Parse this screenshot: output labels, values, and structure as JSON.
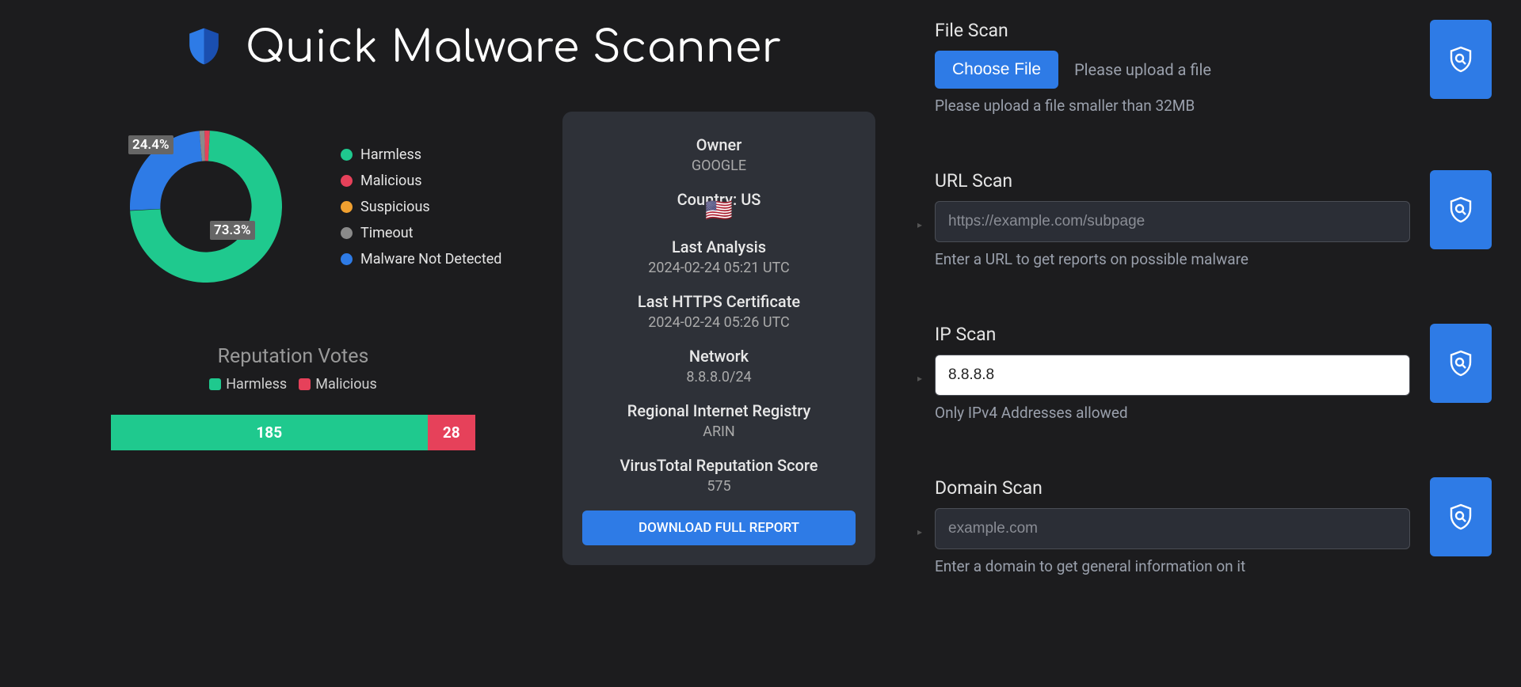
{
  "app": {
    "title": "Quick Malware Scanner"
  },
  "chart_data": {
    "type": "pie",
    "title": "",
    "series": [
      {
        "name": "Harmless",
        "value": 73.3,
        "color": "#1fc98e"
      },
      {
        "name": "Malicious",
        "value": 1.1,
        "color": "#e6415a"
      },
      {
        "name": "Suspicious",
        "value": 0,
        "color": "#f0a030"
      },
      {
        "name": "Timeout",
        "value": 1.1,
        "color": "#8a8a8a"
      },
      {
        "name": "Malware Not Detected",
        "value": 24.4,
        "color": "#2e7be6"
      }
    ],
    "labels_shown": [
      "73.3%",
      "24.4%"
    ]
  },
  "legend": [
    {
      "label": "Harmless",
      "color": "#1fc98e"
    },
    {
      "label": "Malicious",
      "color": "#e6415a"
    },
    {
      "label": "Suspicious",
      "color": "#f0a030"
    },
    {
      "label": "Timeout",
      "color": "#8a8a8a"
    },
    {
      "label": "Malware Not Detected",
      "color": "#2e7be6"
    }
  ],
  "reputation": {
    "title": "Reputation Votes",
    "harmless_label": "Harmless",
    "malicious_label": "Malicious",
    "harmless": 185,
    "malicious": 28
  },
  "info": {
    "owner_label": "Owner",
    "owner": "GOOGLE",
    "country_label": "Country: US",
    "flag": "🇺🇸",
    "last_analysis_label": "Last Analysis",
    "last_analysis": "2024-02-24 05:21 UTC",
    "last_https_label": "Last HTTPS Certificate",
    "last_https": "2024-02-24 05:26 UTC",
    "network_label": "Network",
    "network": "8.8.8.0/24",
    "rir_label": "Regional Internet Registry",
    "rir": "ARIN",
    "vt_label": "VirusTotal Reputation Score",
    "vt_score": "575",
    "download_label": "DOWNLOAD FULL REPORT"
  },
  "scans": {
    "file": {
      "title": "File Scan",
      "button": "Choose File",
      "status": "Please upload a file",
      "helper": "Please upload a file smaller than 32MB"
    },
    "url": {
      "title": "URL Scan",
      "placeholder": "https://example.com/subpage",
      "helper": "Enter a URL to get reports on possible malware"
    },
    "ip": {
      "title": "IP Scan",
      "value": "8.8.8.8",
      "helper": "Only IPv4 Addresses allowed"
    },
    "domain": {
      "title": "Domain Scan",
      "placeholder": "example.com",
      "helper": "Enter a domain to get general information on it"
    }
  }
}
